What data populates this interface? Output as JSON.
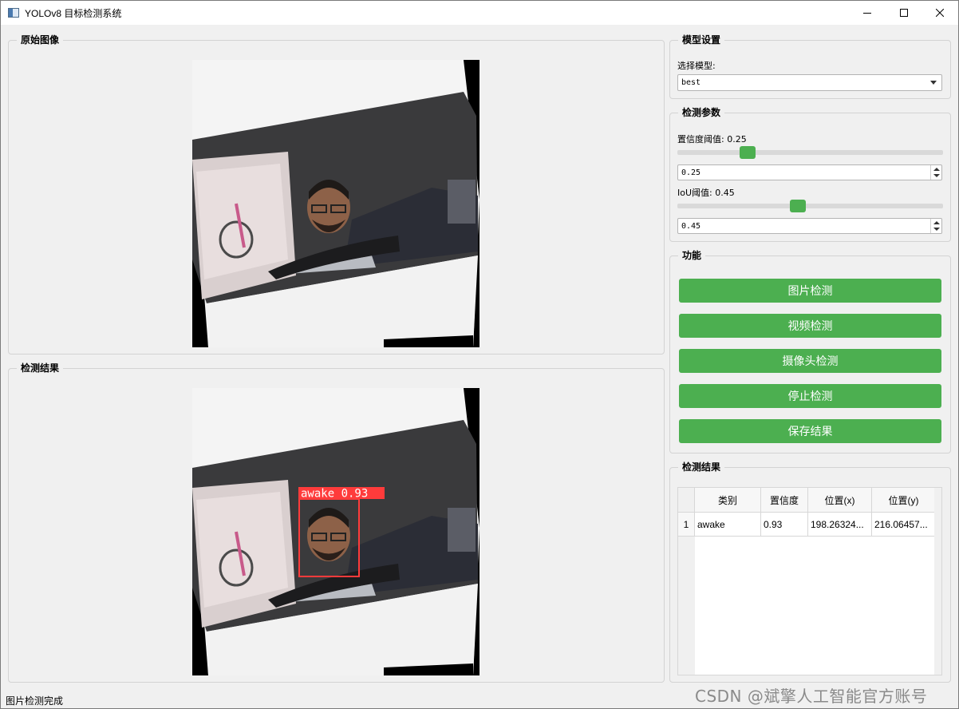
{
  "window": {
    "title": "YOLOv8 目标检测系统"
  },
  "left": {
    "original_title": "原始图像",
    "result_title": "检测结果"
  },
  "detection_box": {
    "label": "awake 0.93"
  },
  "model_settings": {
    "title": "模型设置",
    "select_label": "选择模型:",
    "selected_model": "best"
  },
  "detect_params": {
    "title": "检测参数",
    "conf_label": "置信度阈值: 0.25",
    "conf_value": "0.25",
    "conf_slider": 0.25,
    "iou_label": "IoU阈值: 0.45",
    "iou_value": "0.45",
    "iou_slider": 0.45
  },
  "functions": {
    "title": "功能",
    "buttons": [
      "图片检测",
      "视频检测",
      "摄像头检测",
      "停止检测",
      "保存结果"
    ]
  },
  "results": {
    "title": "检测结果",
    "headers": [
      "类别",
      "置信度",
      "位置(x)",
      "位置(y)"
    ],
    "rows": [
      {
        "index": "1",
        "class": "awake",
        "confidence": "0.93",
        "x": "198.26324...",
        "y": "216.06457..."
      }
    ]
  },
  "status_bar": {
    "text": "图片检测完成"
  },
  "watermark": "CSDN @斌擎人工智能官方账号",
  "colors": {
    "accent_green": "#4caf50",
    "detection_red": "#ff3b3b"
  }
}
